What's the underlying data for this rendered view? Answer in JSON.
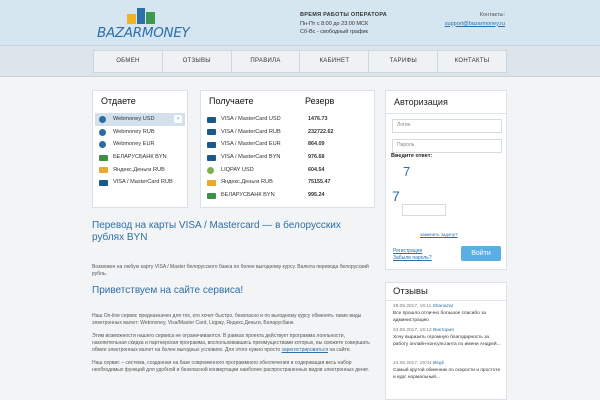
{
  "header": {
    "logo_text": "BAZARMONEY",
    "schedule_title": "ВРЕМЯ РАБОТЫ ОПЕРАТОРА",
    "schedule_line1": "Пн-Пт с 8:00 до 23:00 МСК",
    "schedule_line2": "Сб-Вс - свободный график",
    "contacts_label": "Контакты:",
    "contacts_email": "support@bazarmoney.ru"
  },
  "nav": [
    "ОБМЕН",
    "ОТЗЫВЫ",
    "ПРАВИЛА",
    "КАБИНЕТ",
    "ТАРИФЫ",
    "КОНТАКТЫ"
  ],
  "give": {
    "title": "Отдаете",
    "items": [
      {
        "label": "Webmoney USD",
        "icon": "webmoney-icon"
      },
      {
        "label": "Webmoney RUB",
        "icon": "webmoney-icon"
      },
      {
        "label": "Webmoney EUR",
        "icon": "webmoney-icon"
      },
      {
        "label": "БЕЛАРУСБАНК BYN",
        "icon": "belarusbank-icon"
      },
      {
        "label": "Яндекс.Деньги RUB",
        "icon": "yandex-money-icon"
      },
      {
        "label": "VISA / MasterCard RUB",
        "icon": "card-icon"
      }
    ]
  },
  "get": {
    "title": "Получаете",
    "reserve_title": "Резерв",
    "items": [
      {
        "label": "VISA / MasterCard USD",
        "reserve": "1476.73",
        "icon": "card-icon"
      },
      {
        "label": "VISA / MasterCard RUB",
        "reserve": "232722.62",
        "icon": "card-icon"
      },
      {
        "label": "VISA / MasterCard EUR",
        "reserve": "864.09",
        "icon": "card-icon"
      },
      {
        "label": "VISA / MasterCard BYN",
        "reserve": "976.68",
        "icon": "card-icon"
      },
      {
        "label": "LIQPAY USD",
        "reserve": "604.54",
        "icon": "liqpay-icon"
      },
      {
        "label": "Яндекс.Деньги RUB",
        "reserve": "75155.47",
        "icon": "yandex-money-icon"
      },
      {
        "label": "БЕЛАРУСБАНК BYN",
        "reserve": "995.24",
        "icon": "belarusbank-icon"
      }
    ]
  },
  "content": {
    "heading": "Перевод на карты VISA / Mastercard — в белорусских рублях BYN",
    "intro": "Возможен на любую карту VISA / Master белорусского банка по более выгодному курсу. Валюта перевода белорусский рубль.",
    "welcome": "Приветствуем на сайте сервиса!",
    "body1": "Наш On-line сервис предназначен для тех, кто хочет быстро, безопасно и по выгодному курсу обменять такие виды электронных валют: Webmoney, Visa/Master Card, Liqpay, Яндекс.Деньги, Беларусбанк.",
    "body2": "Этим возможности нашего сервиса не ограничиваются. В рамках проекта действует программа лояльности, накопительная скидка и партнерская программа, воспользовавшись преимуществами которых, вы сможете совершать обмен электронных валют на более выгодных условиях. Для этого нужно просто",
    "body2_link": "зарегистрироваться",
    "body2_end": "на сайте.",
    "body3": "Наш сервис – система, созданная на базе современного программного обеспечения и содержащая весь набор необходимых функций для удобной и безопасной конвертации наиболее распространенных видов электронных денег."
  },
  "auth": {
    "title": "Авторизация",
    "login_placeholder": "Логин",
    "password_placeholder": "Пароль",
    "captcha_label": "Введите ответ:",
    "captcha_1": "7",
    "captcha_2": "7",
    "captcha_refresh": "заменить задачу?",
    "register_link": "Регистрация",
    "forgot_link": "Забыли пароль?",
    "submit": "Войти"
  },
  "reviews": {
    "title": "Отзывы",
    "items": [
      {
        "date": "29.06.2017, 16:11",
        "author": "Shanazar",
        "text": "Все прошло отлично большое спасибо за администрацию"
      },
      {
        "date": "24.06.2017, 15:12",
        "author": "Виктория",
        "text": "Хочу выразить огромную благодарность за работу онлайн-консультанта по имени Андрей..."
      },
      {
        "date": "24.06.2017, 15:04",
        "author": "Begli",
        "text": "Самый крутой обменник по скорости и простоте и курс нормальный..."
      }
    ]
  }
}
